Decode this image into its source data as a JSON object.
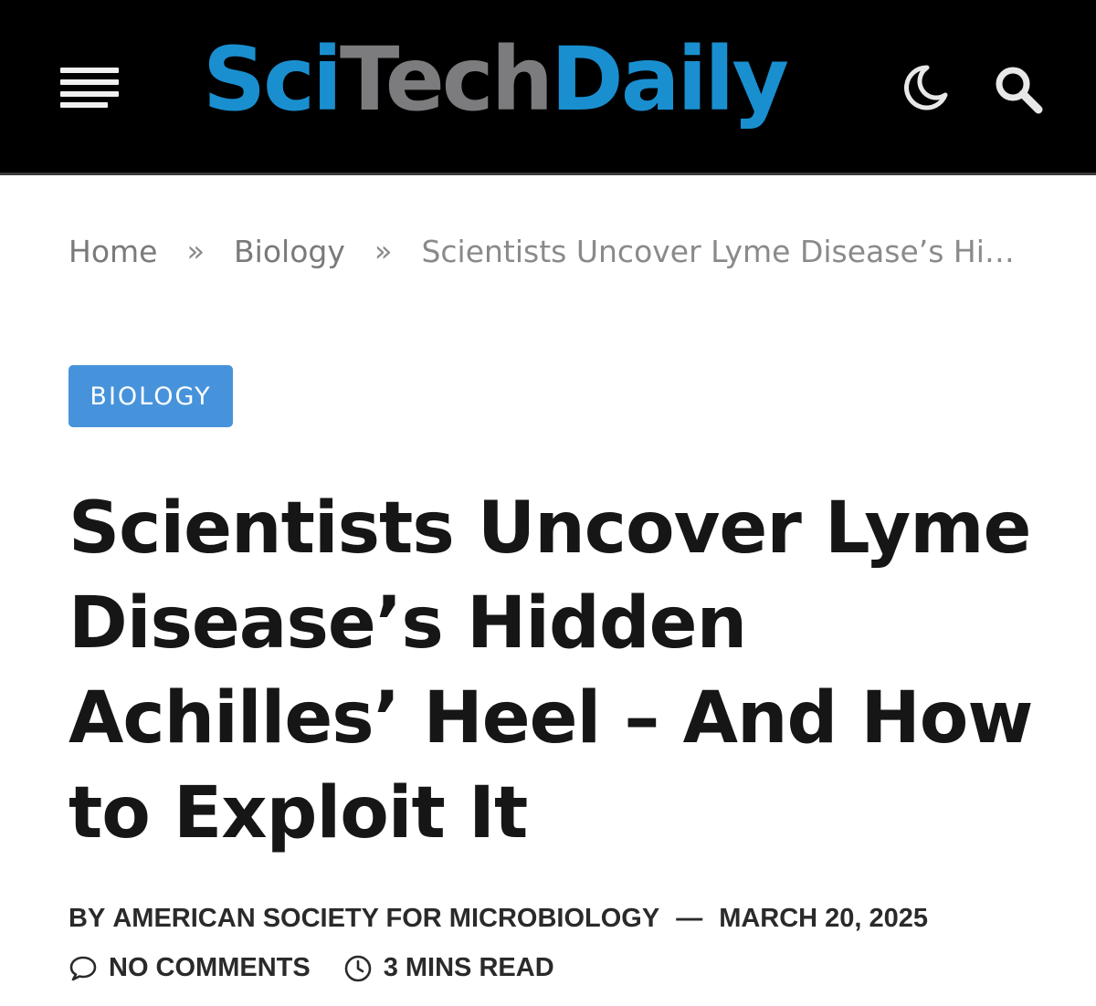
{
  "header": {
    "menu_icon": "hamburger-menu-icon",
    "logo": {
      "part1": "Sci",
      "part2": "Tech",
      "part3": "Daily"
    },
    "brand_colors": {
      "blue": "#1a8fd0",
      "gray": "#7c7c7e"
    },
    "dark_mode_icon": "moon-icon",
    "search_icon": "search-icon"
  },
  "breadcrumb": {
    "home": "Home",
    "separator": "»",
    "category": "Biology",
    "current": "Scientists Uncover Lyme Disease’s Hidden Achilles’ Heel – And How to Exploit It"
  },
  "article": {
    "category_badge": "BIOLOGY",
    "badge_color": "#4693dc",
    "title": "Scientists Uncover Lyme Disease’s Hidden Achilles’ Heel – And How to Exploit It",
    "byline": {
      "prefix": "BY",
      "author": "AMERICAN SOCIETY FOR MICROBIOLOGY",
      "dash": "—",
      "date": "MARCH 20, 2025"
    },
    "meta": {
      "comments_icon": "comment-bubble-icon",
      "comments": "NO COMMENTS",
      "read_time_icon": "clock-icon",
      "read_time": "3 MINS READ"
    }
  }
}
